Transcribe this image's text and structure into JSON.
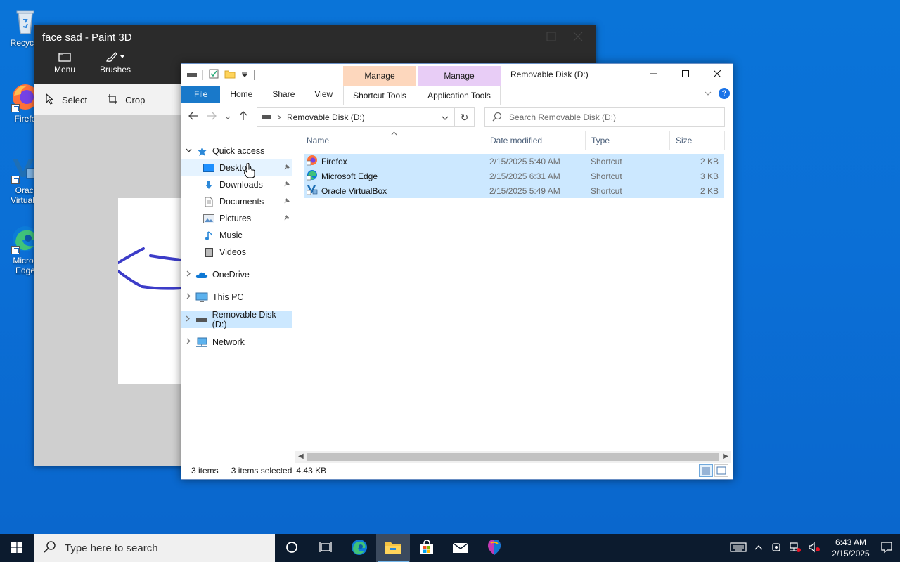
{
  "desktop": {
    "icons": [
      {
        "label": "Recycle",
        "icon": "recycle-bin-icon"
      },
      {
        "label": "Firefo",
        "icon": "firefox-icon"
      },
      {
        "label": "Oracl\nVirtualB",
        "icon": "virtualbox-icon"
      },
      {
        "label": "Micros\nEdge",
        "icon": "edge-icon"
      }
    ]
  },
  "paint3d": {
    "title": "face sad - Paint 3D",
    "ribbon": {
      "menu_label": "Menu",
      "brushes_label": "Brushes"
    },
    "toolbar": {
      "select_label": "Select",
      "crop_label": "Crop"
    }
  },
  "explorer": {
    "title": "Removable Disk (D:)",
    "contextual_tabs": [
      {
        "head": "Manage",
        "sub": "Shortcut Tools",
        "color": "#fdd7bd"
      },
      {
        "head": "Manage",
        "sub": "Application Tools",
        "color": "#e8cdf6"
      }
    ],
    "tabs": [
      "File",
      "Home",
      "Share",
      "View"
    ],
    "address": {
      "location": "Removable Disk (D:)"
    },
    "search": {
      "placeholder": "Search Removable Disk (D:)"
    },
    "nav": [
      {
        "label": "Quick access",
        "icon": "star-icon"
      },
      {
        "label": "Desktop",
        "icon": "desktop-folder-icon"
      },
      {
        "label": "Downloads",
        "icon": "download-icon"
      },
      {
        "label": "Documents",
        "icon": "document-icon"
      },
      {
        "label": "Pictures",
        "icon": "pictures-icon"
      },
      {
        "label": "Music",
        "icon": "music-icon"
      },
      {
        "label": "Videos",
        "icon": "video-icon"
      },
      {
        "label": "OneDrive",
        "icon": "onedrive-icon"
      },
      {
        "label": "This PC",
        "icon": "computer-icon"
      },
      {
        "label": "Removable Disk (D:)",
        "icon": "drive-icon"
      },
      {
        "label": "Network",
        "icon": "network-icon"
      }
    ],
    "columns": {
      "name": "Name",
      "date": "Date modified",
      "type": "Type",
      "size": "Size"
    },
    "files": [
      {
        "name": "Firefox",
        "date": "2/15/2025 5:40 AM",
        "type": "Shortcut",
        "size": "2 KB",
        "icon": "firefox-icon"
      },
      {
        "name": "Microsoft Edge",
        "date": "2/15/2025 6:31 AM",
        "type": "Shortcut",
        "size": "3 KB",
        "icon": "edge-icon"
      },
      {
        "name": "Oracle VirtualBox",
        "date": "2/15/2025 5:49 AM",
        "type": "Shortcut",
        "size": "2 KB",
        "icon": "virtualbox-icon"
      }
    ],
    "status": {
      "count": "3 items",
      "selected": "3 items selected",
      "size": "4.43 KB"
    }
  },
  "taskbar": {
    "search_placeholder": "Type here to search",
    "time": "6:43 AM",
    "date": "2/15/2025"
  },
  "colors": {
    "accent": "#1979ca",
    "selection": "#cce8ff",
    "taskbar": "#0c1b2e",
    "desktop": "#0a74d8"
  }
}
